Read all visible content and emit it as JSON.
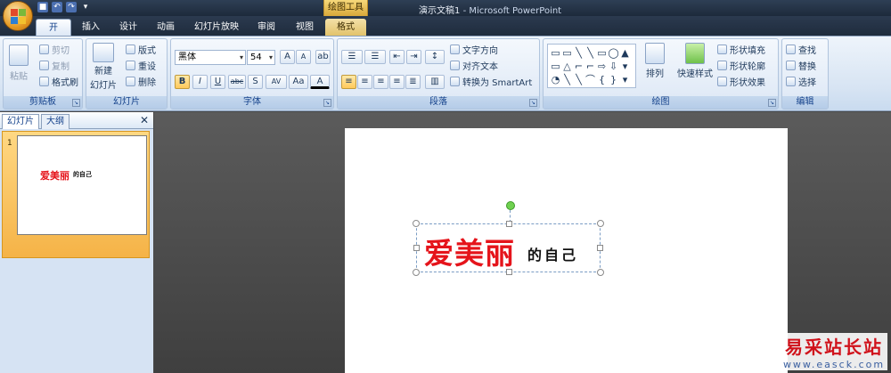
{
  "app": {
    "doc_name": "演示文稿1",
    "app_name": "- Microsoft PowerPoint",
    "context_tools": "绘图工具"
  },
  "tabs": [
    "开始",
    "插入",
    "设计",
    "动画",
    "幻灯片放映",
    "审阅",
    "视图",
    "格式"
  ],
  "ribbon": {
    "clipboard": {
      "label": "剪贴板",
      "paste": "粘贴",
      "cut": "剪切",
      "copy": "复制",
      "format_painter": "格式刷"
    },
    "slides": {
      "label": "幻灯片",
      "new_slide": "新建",
      "new_slide2": "幻灯片",
      "layout": "版式",
      "reset": "重设",
      "delete": "删除"
    },
    "font": {
      "label": "字体",
      "font_name": "黑体",
      "font_size": "54",
      "bold": "B",
      "italic": "I",
      "underline": "U",
      "strike": "abc",
      "shadow": "S",
      "spacing": "AV",
      "case": "Aa",
      "color": "A",
      "grow": "A",
      "shrink": "A"
    },
    "paragraph": {
      "label": "段落",
      "text_direction": "文字方向",
      "align_text": "对齐文本",
      "smartart": "转换为 SmartArt"
    },
    "drawing": {
      "label": "绘图",
      "arrange": "排列",
      "quick_styles": "快速样式",
      "fill": "形状填充",
      "outline": "形状轮廓",
      "effects": "形状效果",
      "shapes": [
        "▭",
        "▭",
        "╲",
        "╲",
        "▭",
        "◯",
        "▲",
        "▭",
        "△",
        "⌐",
        "⌐",
        "⇨",
        "⇩",
        "▾",
        "◔",
        "╲",
        "╲",
        "⌒",
        "{",
        "}",
        "▾"
      ]
    },
    "editing": {
      "label": "编辑",
      "find": "查找",
      "replace": "替换",
      "select": "选择"
    }
  },
  "left_pane": {
    "tab_slides": "幻灯片",
    "tab_outline": "大纲",
    "close": "✕",
    "slide_number": "1",
    "thumb_red": "爱美丽",
    "thumb_black": "的自己"
  },
  "slide": {
    "red_text": "爱美丽",
    "black_text": "的自己"
  },
  "watermark": {
    "line1": "易采站长站",
    "line2": "www.easck.com"
  },
  "colors": {
    "accent_red": "#e5141b",
    "ribbon_blue": "#15428b",
    "thumb_highlight": "#f5b347"
  }
}
